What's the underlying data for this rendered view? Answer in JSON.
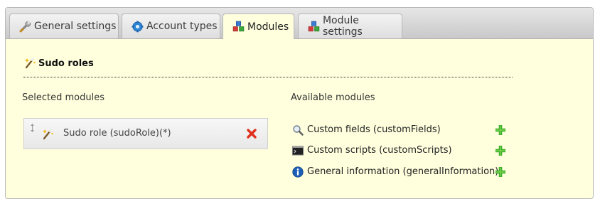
{
  "tabs": [
    {
      "label": "General settings",
      "icon": "wrench-icon",
      "active": false
    },
    {
      "label": "Account types",
      "icon": "gear-icon",
      "active": false
    },
    {
      "label": "Modules",
      "icon": "modules-icon",
      "active": true
    },
    {
      "label": "Module settings",
      "icon": "modules-icon",
      "active": false
    }
  ],
  "section": {
    "title": "Sudo roles",
    "icon": "magic-wand-icon"
  },
  "selected": {
    "heading": "Selected modules",
    "items": [
      {
        "label": "Sudo role (sudoRole)(*)",
        "icon": "magic-wand-icon"
      }
    ]
  },
  "available": {
    "heading": "Available modules",
    "items": [
      {
        "label": "Custom fields (customFields)",
        "icon": "magnifier-icon"
      },
      {
        "label": "Custom scripts (customScripts)",
        "icon": "terminal-icon"
      },
      {
        "label": "General information (generalInformation)",
        "icon": "info-icon"
      }
    ]
  },
  "colors": {
    "panel_bg": "#ffffde",
    "remove": "#e0301e",
    "add": "#3fae2a",
    "info": "#1d5fb8"
  }
}
